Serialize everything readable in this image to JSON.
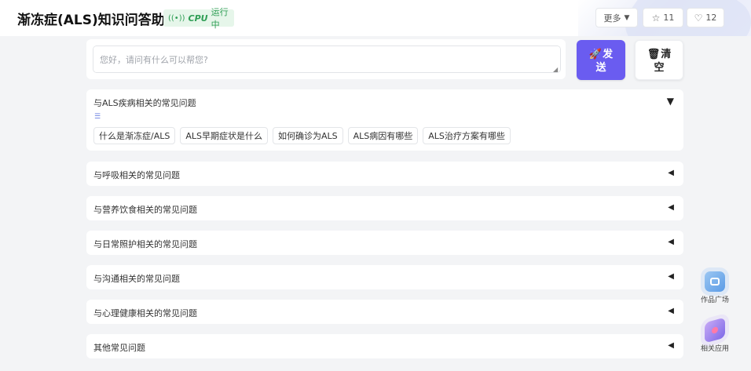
{
  "header": {
    "title": "渐冻症(ALS)知识问答助手",
    "status": {
      "cpu_label": "CPU",
      "state": "运行中"
    },
    "more_label": "更多",
    "star_count": "11",
    "like_count": "12"
  },
  "input": {
    "placeholder": "您好，请问有什么可以帮您?",
    "value": ""
  },
  "buttons": {
    "send": {
      "line1": "发",
      "line2": "送"
    },
    "clear": {
      "line1": "清",
      "line2": "空"
    }
  },
  "accordions": [
    {
      "title": "与ALS疾病相关的常见问题",
      "expanded": true,
      "chips": [
        "什么是渐冻症/ALS",
        "ALS早期症状是什么",
        "如何确诊为ALS",
        "ALS病因有哪些",
        "ALS治疗方案有哪些"
      ]
    },
    {
      "title": "与呼吸相关的常见问题",
      "expanded": false
    },
    {
      "title": "与营养饮食相关的常见问题",
      "expanded": false
    },
    {
      "title": "与日常照护相关的常见问题",
      "expanded": false
    },
    {
      "title": "与沟通相关的常见问题",
      "expanded": false
    },
    {
      "title": "与心理健康相关的常见问题",
      "expanded": false
    },
    {
      "title": "其他常见问题",
      "expanded": false
    }
  ],
  "side": {
    "plaza_label": "作品广场",
    "apps_label": "相关应用"
  },
  "icons": {
    "send": "rocket-icon",
    "clear": "trash-icon",
    "star": "star-icon",
    "like": "heart-icon",
    "status": "signal-icon",
    "list": "list-icon"
  },
  "colors": {
    "accent": "#6a5cf0",
    "status_green": "#2f9e55",
    "status_bg": "#e6f6ea"
  }
}
